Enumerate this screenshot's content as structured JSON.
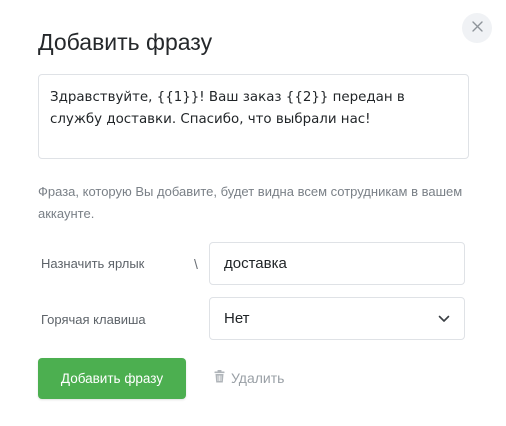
{
  "dialog": {
    "title": "Добавить фразу",
    "close_icon": "close-icon",
    "phrase_text": "Здравствуйте, {{1}}! Ваш заказ {{2}} передан в службу доставки. Спасибо, что выбрали нас!",
    "hint": "Фраза, которую Вы добавите, будет видна всем сотрудникам в вашем аккаунте.",
    "label_field": {
      "label": "Назначить ярлык",
      "prefix": "\\",
      "value": "доставка"
    },
    "hotkey_field": {
      "label": "Горячая клавиша",
      "selected": "Нет",
      "icon": "chevron-down-icon"
    },
    "actions": {
      "submit_label": "Добавить фразу",
      "delete_label": "Удалить",
      "delete_icon": "trash-icon"
    }
  },
  "colors": {
    "accent": "#4caf50",
    "border": "#dfe2e6",
    "muted": "#9aa0a6"
  }
}
